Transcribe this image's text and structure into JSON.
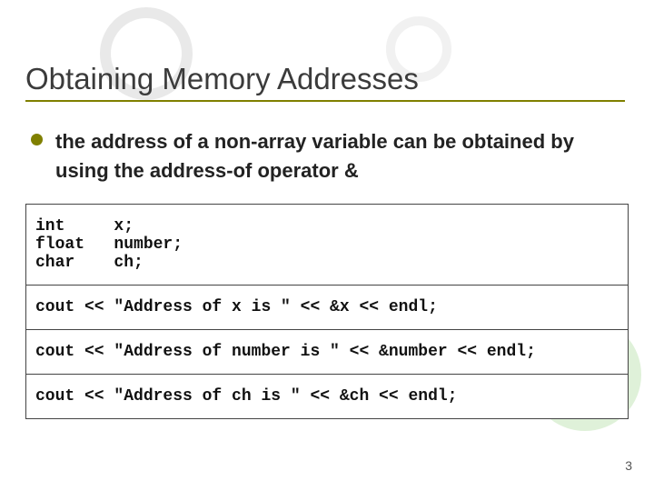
{
  "title": "Obtaining Memory Addresses",
  "bullet": "the address of a non-array variable can be obtained by using the address-of operator &",
  "code": {
    "decl": "int     x;\nfloat   number;\nchar    ch;",
    "line1": "cout << \"Address of x is \" << &x << endl;",
    "line2": "cout << \"Address of number is \" << &number << endl;",
    "line3": "cout << \"Address of ch is \" << &ch << endl;"
  },
  "page": "3"
}
